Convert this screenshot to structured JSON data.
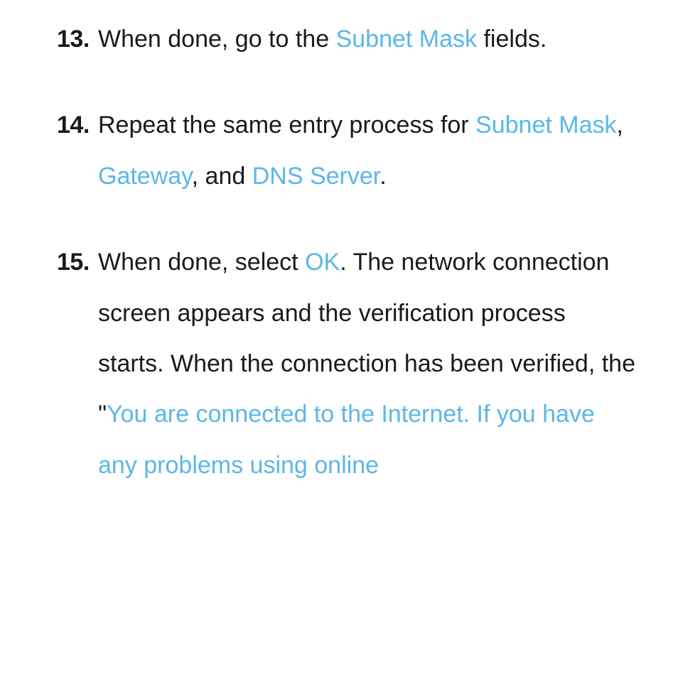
{
  "items": [
    {
      "number": "13.",
      "parts": [
        {
          "text": "When done, go to the "
        },
        {
          "text": "Subnet Mask",
          "highlight": true
        },
        {
          "text": " fields."
        }
      ]
    },
    {
      "number": "14.",
      "parts": [
        {
          "text": "Repeat the same entry process for "
        },
        {
          "text": "Subnet Mask",
          "highlight": true
        },
        {
          "text": ", "
        },
        {
          "text": "Gateway",
          "highlight": true
        },
        {
          "text": ", and "
        },
        {
          "text": "DNS Server",
          "highlight": true
        },
        {
          "text": "."
        }
      ]
    },
    {
      "number": "15.",
      "parts": [
        {
          "text": "When done, select "
        },
        {
          "text": "OK",
          "highlight": true
        },
        {
          "text": ". The network connection screen appears and the verification process starts. When the connection has been verified, the \""
        },
        {
          "text": "You are connected to the Internet. If you have any problems using online",
          "highlight": true
        }
      ]
    }
  ]
}
